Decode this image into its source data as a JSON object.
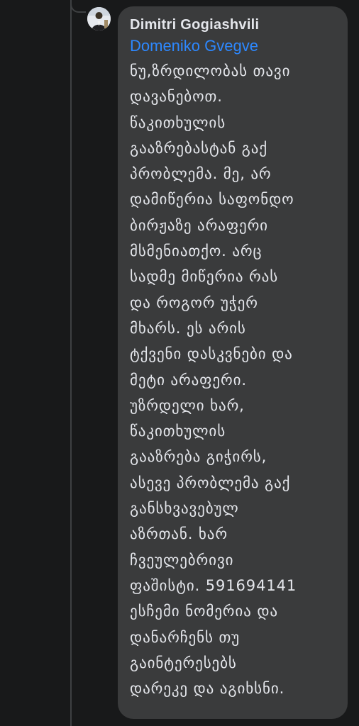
{
  "comment": {
    "author": "Dimitri Gogiashvili",
    "mention": "Domeniko Gvegve",
    "lines": [
      "ნუ,ზრდილობას თავი",
      "დავანებოთ.",
      "წაკითხულის",
      "გააზრებასტან გაქ",
      "პრობლემა. მე, არ",
      "დამიწერია საფონდო",
      "ბირჟაზე არაფერი",
      "მსმენიათქო. არც",
      "სადმე მიწერია რას",
      "და როგორ უჭერ",
      "მხარს. ეს არის",
      "ტქვენი დასკვნები და",
      "მეტი არაფერი.",
      "უზრდელი ხარ,",
      "წაკითხულის",
      "გააზრება გიჭირს,",
      "ასევე პრობლემა გაქ",
      "განსხვავებულ",
      "აზრთან. ხარ",
      "ჩვეულებრივი",
      "ფაშისტი. 591694141",
      "ესჩემი ნომერია და",
      "დანარჩენს თუ",
      "გაინტერესებს",
      "დარეკე და აგიხსნი."
    ]
  },
  "colors": {
    "background": "#18191a",
    "bubble": "#3a3b3c",
    "text": "#e4e6eb",
    "mention": "#2d88ff",
    "thread_line": "#3e4042"
  },
  "icons": {
    "avatar": "profile-photo"
  }
}
